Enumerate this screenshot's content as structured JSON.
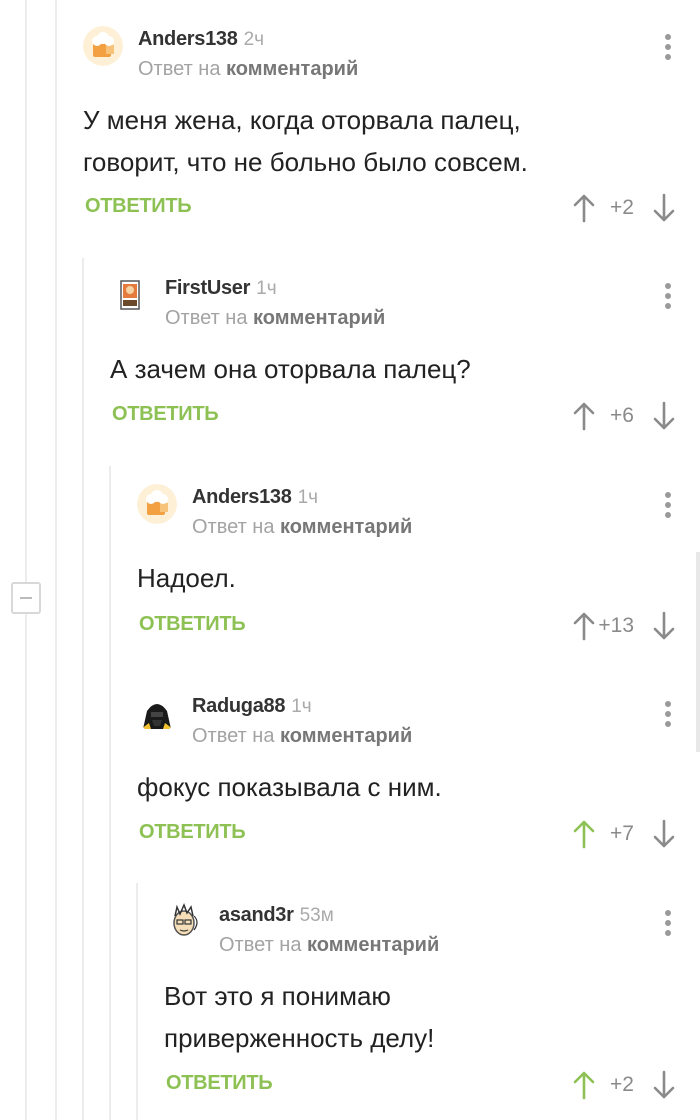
{
  "comments": [
    {
      "author": "Anders138",
      "time": "2ч",
      "reply_prefix": "Ответ на",
      "reply_ref": "комментарий",
      "text": "У меня жена, когда оторвала палец, говорит, что не больно было совсем.",
      "reply_label": "ОТВЕТИТЬ",
      "score": "+2",
      "avatar": "anders-avatar",
      "upvoted": false
    },
    {
      "author": "FirstUser",
      "time": "1ч",
      "reply_prefix": "Ответ на",
      "reply_ref": "комментарий",
      "text": "А зачем она оторвала палец?",
      "reply_label": "ОТВЕТИТЬ",
      "score": "+6",
      "avatar": "firstuser-avatar",
      "upvoted": false
    },
    {
      "author": "Anders138",
      "time": "1ч",
      "reply_prefix": "Ответ на",
      "reply_ref": "комментарий",
      "text": "Надоел.",
      "reply_label": "ОТВЕТИТЬ",
      "score": "+13",
      "avatar": "anders-avatar",
      "upvoted": false
    },
    {
      "author": "Raduga88",
      "time": "1ч",
      "reply_prefix": "Ответ на",
      "reply_ref": "комментарий",
      "text": "фокус показывала с ним.",
      "reply_label": "ОТВЕТИТЬ",
      "score": "+7",
      "avatar": "raduga-avatar",
      "upvoted": true
    },
    {
      "author": "asand3r",
      "time": "53м",
      "reply_prefix": "Ответ на",
      "reply_ref": "комментарий",
      "text": "Вот это я понимаю приверженность делу!",
      "reply_label": "ОТВЕТИТЬ",
      "score": "+2",
      "avatar": "asand3r-avatar",
      "upvoted": true
    }
  ],
  "colors": {
    "accent": "#8dc154",
    "arrow": "#8a8a8a",
    "muted": "#a3a3a3",
    "thread_line": "#ececec"
  }
}
